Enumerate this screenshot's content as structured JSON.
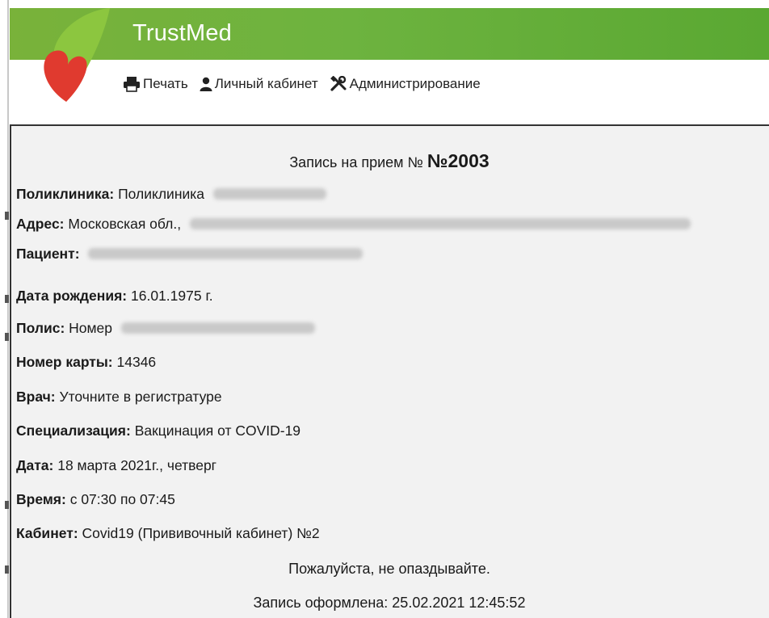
{
  "app": {
    "brand": "TrustMed"
  },
  "menu": [
    {
      "label": "Печать",
      "icon": "printer-icon"
    },
    {
      "label": "Личный кабинет",
      "icon": "user-icon"
    },
    {
      "label": "Администрирование",
      "icon": "tools-icon"
    }
  ],
  "ticket": {
    "title_prefix": "Запись на прием №",
    "number": "№2003",
    "clinic_label": "Поликлиника:",
    "clinic_value": "Поликлиника",
    "address_label": "Адрес:",
    "address_value": "Московская обл.,",
    "patient_label": "Пациент:",
    "birth_label": "Дата рождения:",
    "birth_value": "16.01.1975 г.",
    "policy_label": "Полис:",
    "policy_value": "Номер",
    "card_label": "Номер карты:",
    "card_value": "14346",
    "doctor_label": "Врач:",
    "doctor_value": "Уточните в регистратуре",
    "spec_label": "Специализация:",
    "spec_value": "Вакцинация от COVID-19",
    "date_label": "Дата:",
    "date_value": "18 марта 2021г., четверг",
    "time_label": "Время:",
    "time_value": "с 07:30 по 07:45",
    "room_label": "Кабинет:",
    "room_value": "Covid19 (Прививочный кабинет) №2",
    "notice": "Пожалуйста, не опаздывайте.",
    "created": "Запись оформлена: 25.02.2021 12:45:52"
  },
  "colors": {
    "header_green": "#6db33f",
    "logo_red": "#e03a2f",
    "logo_green": "#8cc63f",
    "content_bg": "#f2f2f2"
  }
}
